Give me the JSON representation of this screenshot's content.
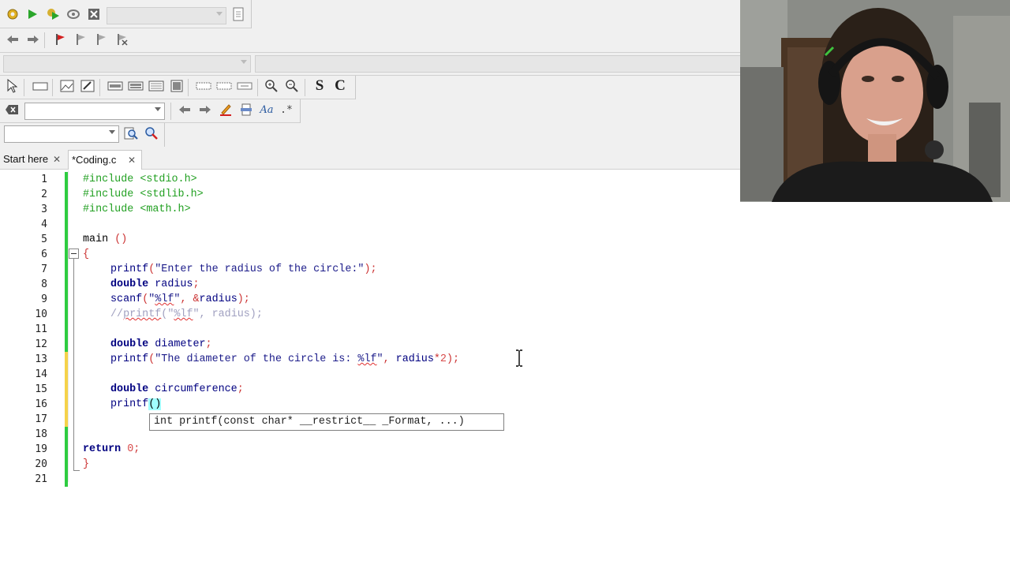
{
  "toolbar": {
    "compiler_combo": "",
    "search_combo": "",
    "jump_combo": "",
    "regex_label": ".*",
    "s_label": "S",
    "c_label": "C"
  },
  "tabs": [
    {
      "label": "Start here",
      "active": false
    },
    {
      "label": "*Coding.c",
      "active": true
    }
  ],
  "editor": {
    "lines": [
      {
        "no": "1",
        "change": "green"
      },
      {
        "no": "2",
        "change": "green"
      },
      {
        "no": "3",
        "change": "green"
      },
      {
        "no": "4",
        "change": "green"
      },
      {
        "no": "5",
        "change": "green"
      },
      {
        "no": "6",
        "change": "green"
      },
      {
        "no": "7",
        "change": "green"
      },
      {
        "no": "8",
        "change": "green"
      },
      {
        "no": "9",
        "change": "green"
      },
      {
        "no": "10",
        "change": "green"
      },
      {
        "no": "11",
        "change": "green"
      },
      {
        "no": "12",
        "change": "green"
      },
      {
        "no": "13",
        "change": "yellow"
      },
      {
        "no": "14",
        "change": "yellow"
      },
      {
        "no": "15",
        "change": "yellow"
      },
      {
        "no": "16",
        "change": "yellow"
      },
      {
        "no": "17",
        "change": "yellow"
      },
      {
        "no": "18",
        "change": "green"
      },
      {
        "no": "19",
        "change": "green"
      },
      {
        "no": "20",
        "change": "green"
      },
      {
        "no": "21",
        "change": "green"
      }
    ],
    "code": {
      "l1": "#include <stdio.h>",
      "l2": "#include <stdlib.h>",
      "l3": "#include <math.h>",
      "l5a": "main ",
      "l5b": "()",
      "l6": "{",
      "l7a": "printf",
      "l7b": "(",
      "l7c": "\"Enter the radius of the circle:\"",
      "l7d": ");",
      "l8a": "double",
      "l8b": " radius",
      "l8c": ";",
      "l9a": "scanf",
      "l9b": "(",
      "l9c": "\"",
      "l9d": "%lf",
      "l9e": "\"",
      "l9f": ", &",
      "l9g": "radius",
      "l9h": ");",
      "l10a": "//",
      "l10b": "printf",
      "l10c": "(\"",
      "l10d": "%lf",
      "l10e": "\", radius);",
      "l12a": "double",
      "l12b": " diameter",
      "l12c": ";",
      "l13a": "printf",
      "l13b": "(",
      "l13c": "\"The diameter of the circle is: ",
      "l13d": "%lf",
      "l13e": "\"",
      "l13f": ", ",
      "l13g": "radius",
      "l13h": "*",
      "l13i": "2",
      "l13j": ");",
      "l15a": "double",
      "l15b": " circumference",
      "l15c": ";",
      "l16a": "printf",
      "l16b": "()",
      "l19a": "return",
      "l19b": " 0",
      "l19c": ";",
      "l20": "}"
    },
    "calltip": "int printf(const char* __restrict__ _Format, ...)"
  },
  "colors": {
    "change_green": "#2ecc40",
    "change_yellow": "#f5d24a",
    "brace_match": "#a0ffff"
  }
}
